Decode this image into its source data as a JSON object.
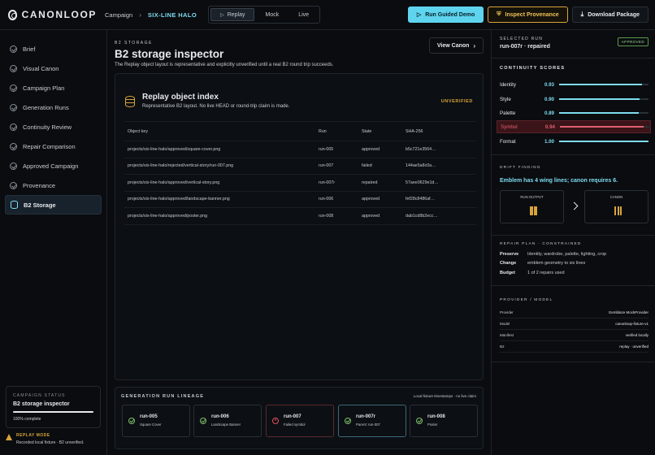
{
  "brand": {
    "name": "CANONLOOP"
  },
  "breadcrumb": {
    "campaign": "Campaign",
    "current": "SIX-LINE HALO"
  },
  "modes": [
    {
      "label": "Replay"
    },
    {
      "label": "Mock"
    },
    {
      "label": "Live"
    }
  ],
  "actions": {
    "run": "Run Guided Demo",
    "inspect": "Inspect Provenance",
    "download": "Download Package"
  },
  "sidebar": {
    "items": [
      {
        "label": "Brief"
      },
      {
        "label": "Visual Canon"
      },
      {
        "label": "Campaign Plan"
      },
      {
        "label": "Generation Runs"
      },
      {
        "label": "Continuity Review"
      },
      {
        "label": "Repair Comparison"
      },
      {
        "label": "Approved Campaign"
      },
      {
        "label": "Provenance"
      },
      {
        "label": "B2 Storage"
      }
    ],
    "status": {
      "label": "CAMPAIGN STATUS",
      "title": "B2 storage inspector",
      "progress": 100,
      "progress_text": "100% complete"
    },
    "replay": {
      "title": "REPLAY MODE",
      "text": "Recorded local fixture · B2 unverified."
    }
  },
  "main": {
    "eyebrow": "B2 STORAGE",
    "title": "B2 storage inspector",
    "subtitle": "The Replay object layout is representative and explicitly unverified until a real B2 round trip succeeds.",
    "view_canon": "View Canon",
    "index": {
      "title": "Replay object index",
      "subtitle": "Representative B2 layout. No live HEAD or round-trip claim is made.",
      "badge": "UNVERIFIED",
      "headers": [
        "Object key",
        "Run",
        "State",
        "SHA-256"
      ],
      "rows": [
        {
          "key": "projects/six-line-halo/approved/square-cover.png",
          "run": "run-005",
          "state": "approved",
          "sha": "b5c721e3564…"
        },
        {
          "key": "projects/six-line-halo/rejected/vertical-story/run-007.png",
          "run": "run-007",
          "state": "failed",
          "sha": "144ae5a8c0a…"
        },
        {
          "key": "projects/six-line-halo/approved/vertical-story.png",
          "run": "run-007r",
          "state": "repaired",
          "sha": "57aee0629e1d…"
        },
        {
          "key": "projects/six-line-halo/approved/landscape-banner.png",
          "run": "run-006",
          "state": "approved",
          "sha": "fef28c8486af…"
        },
        {
          "key": "projects/six-line-halo/approved/poster.png",
          "run": "run-008",
          "state": "approved",
          "sha": "dab1cd8b2ecc…"
        }
      ]
    },
    "lineage": {
      "title": "GENERATION RUN LINEAGE",
      "note": "Local fixture timestamps · no live claim",
      "runs": [
        {
          "id": "run-005",
          "desc": "Square Cover",
          "status": "ok"
        },
        {
          "id": "run-006",
          "desc": "Landscape Banner",
          "status": "ok"
        },
        {
          "id": "run-007",
          "desc": "Failed symbol",
          "status": "failed"
        },
        {
          "id": "run-007r",
          "desc": "Parent: run-007",
          "status": "ok"
        },
        {
          "id": "run-008",
          "desc": "Poster",
          "status": "ok"
        }
      ]
    }
  },
  "right": {
    "selected_label": "SELECTED RUN",
    "selected_run": "run-007r · repaired",
    "approved": "APPROVED",
    "continuity_title": "CONTINUITY SCORES",
    "scores": [
      {
        "name": "Identity",
        "value": "0.93",
        "level": 0.93
      },
      {
        "name": "Style",
        "value": "0.90",
        "level": 0.9
      },
      {
        "name": "Palette",
        "value": "0.89",
        "level": 0.89
      },
      {
        "name": "Symbol",
        "value": "0.94",
        "level": 0.94
      },
      {
        "name": "Format",
        "value": "1.00",
        "level": 1.0
      }
    ],
    "drift_title": "DRIFT FINDING",
    "drift_text": "Emblem has 4 wing lines; canon requires 6.",
    "run_output": "RUN OUTPUT",
    "canon": "CANON",
    "repair_title": "REPAIR PLAN · CONSTRAINED",
    "repair": [
      {
        "k": "Preserve",
        "v": "Identity, wardrobe, palette, lighting, crop"
      },
      {
        "k": "Change",
        "v": "emblem geometry to six lines"
      },
      {
        "k": "Budget",
        "v": "1 of 2 repairs used"
      }
    ],
    "provider_title": "PROVIDER / MODEL",
    "provider": [
      {
        "k": "Provider",
        "v": "Gemblaze MockProvider"
      },
      {
        "k": "Model",
        "v": "canonloop-fixture-v1"
      },
      {
        "k": "Manifest",
        "v": "verified locally"
      },
      {
        "k": "B2",
        "v": "replay · unverified"
      }
    ]
  }
}
